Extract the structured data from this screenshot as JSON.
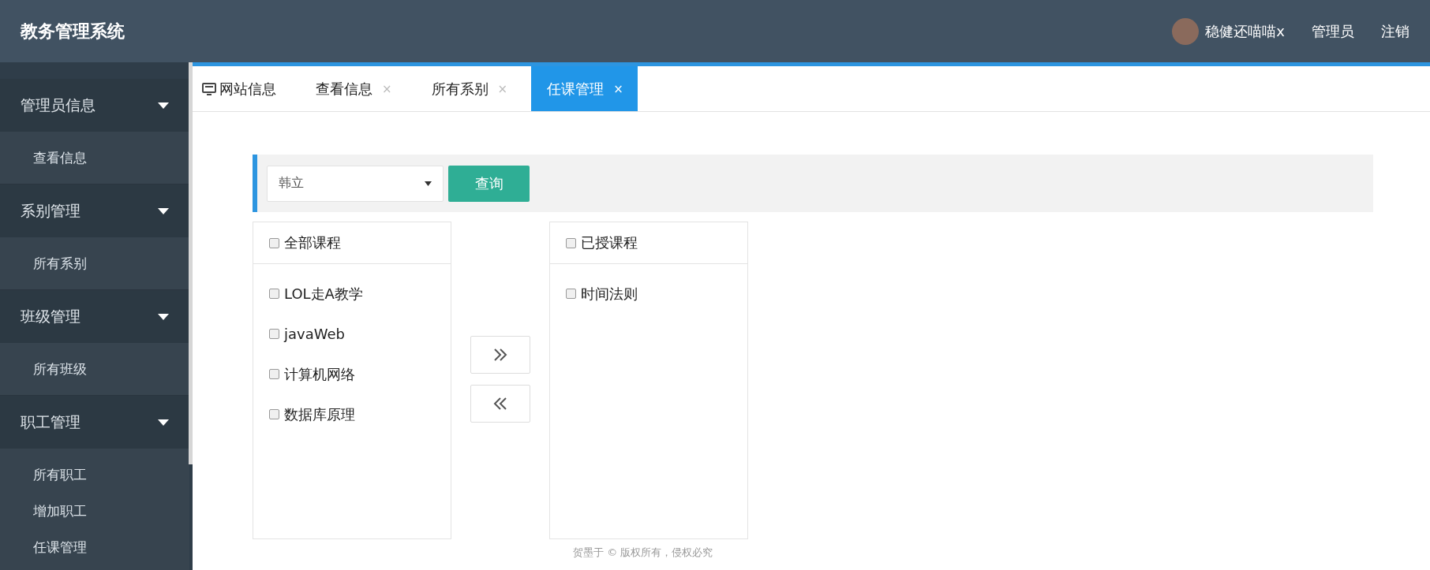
{
  "header": {
    "title": "教务管理系统",
    "user": "稳健还喵喵x",
    "links": [
      "管理员",
      "注销"
    ]
  },
  "sidebar": {
    "groups": [
      {
        "label": "管理员信息",
        "expanded": true,
        "items": [
          "查看信息"
        ]
      },
      {
        "label": "系别管理",
        "expanded": true,
        "items": [
          "所有系别"
        ]
      },
      {
        "label": "班级管理",
        "expanded": true,
        "items": [
          "所有班级"
        ]
      },
      {
        "label": "职工管理",
        "expanded": true,
        "items": [
          "所有职工",
          "增加职工",
          "任课管理"
        ]
      }
    ]
  },
  "tabs": [
    {
      "label": "网站信息",
      "kind": "home",
      "selected": false
    },
    {
      "label": "查看信息",
      "kind": "closable",
      "selected": false,
      "close": "×"
    },
    {
      "label": "所有系别",
      "kind": "closable",
      "selected": false,
      "close": "×"
    },
    {
      "label": "任课管理",
      "kind": "closable",
      "selected": true,
      "close": "×"
    }
  ],
  "filter": {
    "teacher_select": {
      "value": "韩立"
    },
    "query_button": "查询"
  },
  "available": {
    "header": {
      "label": "全部课程",
      "checked": false
    },
    "items": [
      {
        "label": "LOL走A教学",
        "checked": false
      },
      {
        "label": "javaWeb",
        "checked": false
      },
      {
        "label": "计算机网络",
        "checked": false
      },
      {
        "label": "数据库原理",
        "checked": false
      }
    ]
  },
  "assigned": {
    "header": {
      "label": "已授课程",
      "checked": false
    },
    "items": [
      {
        "label": "时间法则",
        "checked": false
      }
    ]
  },
  "footer": "贺墨于 © 版权所有，侵权必究"
}
